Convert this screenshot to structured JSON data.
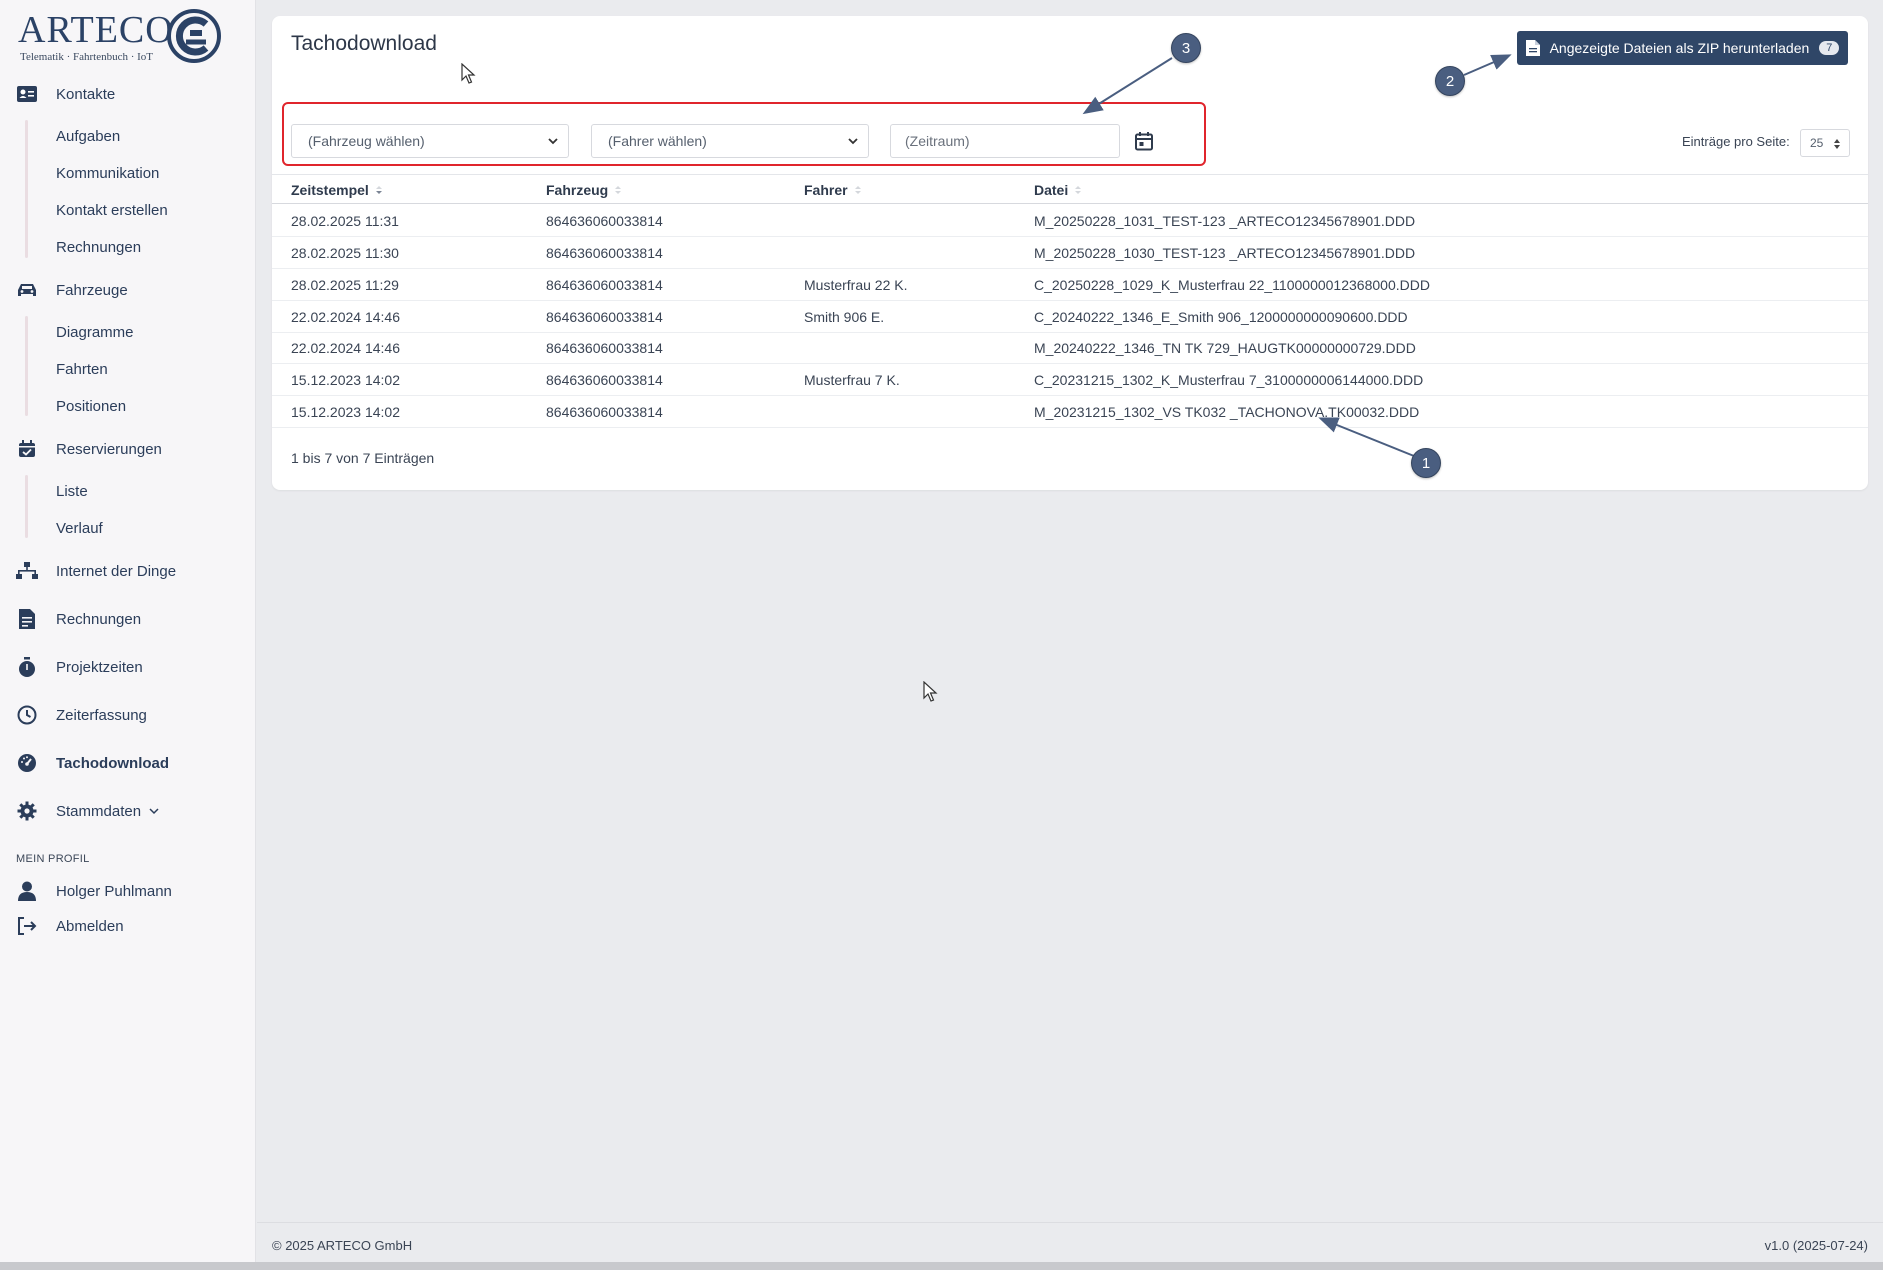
{
  "logo": {
    "name": "ARTECO",
    "tagline": "Telematik · Fahrtenbuch · IoT"
  },
  "sidebar": {
    "kontakte": {
      "label": "Kontakte",
      "icon": "contact-card-icon",
      "children": [
        "Aufgaben",
        "Kommunikation",
        "Kontakt erstellen",
        "Rechnungen"
      ]
    },
    "fahrzeuge": {
      "label": "Fahrzeuge",
      "icon": "car-icon",
      "children": [
        "Diagramme",
        "Fahrten",
        "Positionen"
      ]
    },
    "reservierungen": {
      "label": "Reservierungen",
      "icon": "calendar-check-icon",
      "children": [
        "Liste",
        "Verlauf"
      ]
    },
    "iot": {
      "label": "Internet der Dinge",
      "icon": "network-icon"
    },
    "rechnungen": {
      "label": "Rechnungen",
      "icon": "invoice-icon"
    },
    "projektzeiten": {
      "label": "Projektzeiten",
      "icon": "stopwatch-icon"
    },
    "zeiterfassung": {
      "label": "Zeiterfassung",
      "icon": "clock-icon"
    },
    "tachodownload": {
      "label": "Tachodownload",
      "icon": "tachometer-icon",
      "active": true
    },
    "stammdaten": {
      "label": "Stammdaten",
      "icon": "gear-icon"
    },
    "profile_section": "MEIN PROFIL",
    "user": {
      "label": "Holger Puhlmann",
      "icon": "user-icon"
    },
    "logout": {
      "label": "Abmelden",
      "icon": "logout-icon"
    }
  },
  "main": {
    "title": "Tachodownload",
    "zip_button": {
      "label": "Angezeigte Dateien als ZIP herunterladen",
      "count": "7"
    },
    "filters": {
      "vehicle": "(Fahrzeug wählen)",
      "driver": "(Fahrer wählen)",
      "range_placeholder": "(Zeitraum)"
    },
    "per_page": {
      "label": "Einträge pro Seite:",
      "value": "25"
    },
    "table": {
      "columns": [
        "Zeitstempel",
        "Fahrzeug",
        "Fahrer",
        "Datei"
      ],
      "rows": [
        [
          "28.02.2025 11:31",
          "864636060033814",
          "",
          "M_20250228_1031_TEST-123 _ARTECO12345678901.DDD"
        ],
        [
          "28.02.2025 11:30",
          "864636060033814",
          "",
          "M_20250228_1030_TEST-123 _ARTECO12345678901.DDD"
        ],
        [
          "28.02.2025 11:29",
          "864636060033814",
          "Musterfrau 22 K.",
          "C_20250228_1029_K_Musterfrau 22_1100000012368000.DDD"
        ],
        [
          "22.02.2024 14:46",
          "864636060033814",
          "Smith 906 E.",
          "C_20240222_1346_E_Smith 906_1200000000090600.DDD"
        ],
        [
          "22.02.2024 14:46",
          "864636060033814",
          "",
          "M_20240222_1346_TN TK 729_HAUGTK00000000729.DDD"
        ],
        [
          "15.12.2023 14:02",
          "864636060033814",
          "Musterfrau 7 K.",
          "C_20231215_1302_K_Musterfrau 7_3100000006144000.DDD"
        ],
        [
          "15.12.2023 14:02",
          "864636060033814",
          "",
          "M_20231215_1302_VS TK032 _TACHONOVA.TK00032.DDD"
        ]
      ],
      "info": "1 bis 7 von 7 Einträgen"
    }
  },
  "annotations": [
    "1",
    "2",
    "3"
  ],
  "footer": {
    "copyright": "© 2025 ARTECO GmbH",
    "version": "v1.0 (2025-07-24)"
  },
  "colors": {
    "primary": "#2f4667",
    "highlight_box": "#e0252c",
    "callout": "#4a5e80",
    "background": "#eaebee"
  }
}
